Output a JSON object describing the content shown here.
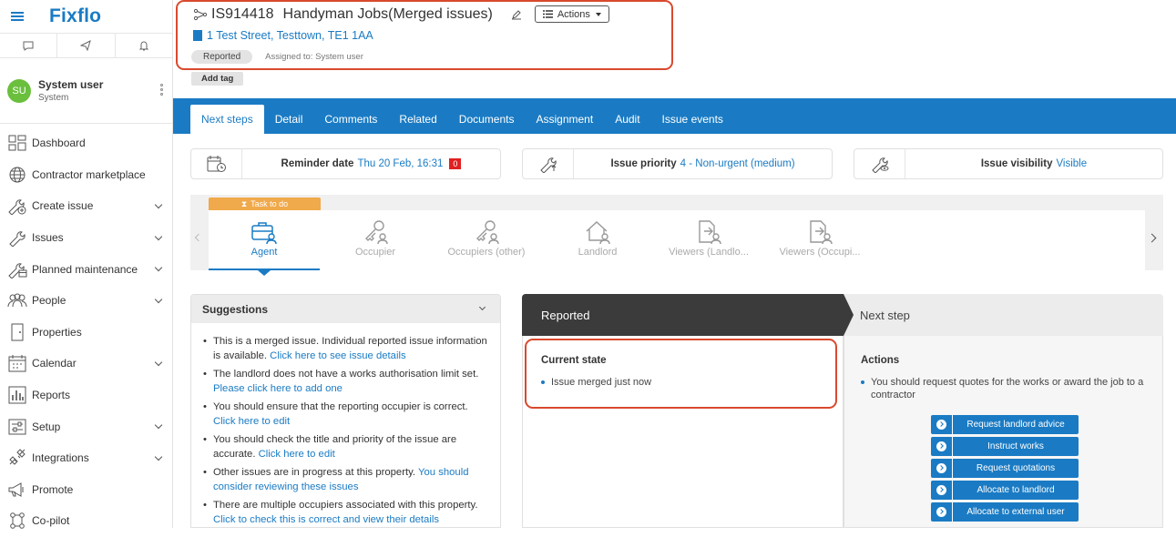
{
  "app": {
    "name": "Fixflo"
  },
  "sidebar": {
    "quick_icons": [
      "chat-icon",
      "send-icon",
      "bell-icon"
    ],
    "user": {
      "initials": "SU",
      "name": "System user",
      "role": "System",
      "avatar_color": "#6abf3d"
    },
    "items": [
      {
        "label": "Dashboard",
        "icon": "dashboard-icon",
        "has_submenu": false
      },
      {
        "label": "Contractor marketplace",
        "icon": "globe-icon",
        "has_submenu": false
      },
      {
        "label": "Create issue",
        "icon": "wrench-plus-icon",
        "has_submenu": true
      },
      {
        "label": "Issues",
        "icon": "wrench-icon",
        "has_submenu": true
      },
      {
        "label": "Planned maintenance",
        "icon": "wrench-calendar-icon",
        "has_submenu": true
      },
      {
        "label": "People",
        "icon": "people-icon",
        "has_submenu": true
      },
      {
        "label": "Properties",
        "icon": "door-icon",
        "has_submenu": false
      },
      {
        "label": "Calendar",
        "icon": "calendar-icon",
        "has_submenu": true
      },
      {
        "label": "Reports",
        "icon": "reports-icon",
        "has_submenu": false
      },
      {
        "label": "Setup",
        "icon": "setup-icon",
        "has_submenu": true
      },
      {
        "label": "Integrations",
        "icon": "integrations-icon",
        "has_submenu": true
      },
      {
        "label": "Promote",
        "icon": "megaphone-icon",
        "has_submenu": false
      },
      {
        "label": "Co-pilot",
        "icon": "copilot-icon",
        "has_submenu": false
      }
    ]
  },
  "issue": {
    "ref": "IS914418",
    "title": "Handyman Jobs(Merged issues)",
    "actions_label": "Actions",
    "address": "1 Test Street, Testtown, TE1 1AA",
    "status": "Reported",
    "assigned": "Assigned to: System user",
    "add_tag": "Add tag"
  },
  "tabs": [
    "Next steps",
    "Detail",
    "Comments",
    "Related",
    "Documents",
    "Assignment",
    "Audit",
    "Issue events"
  ],
  "cards": {
    "reminder": {
      "label": "Reminder date",
      "value": "Thu 20 Feb, 16:31",
      "badge": "0"
    },
    "priority": {
      "label": "Issue priority",
      "value": "4 - Non-urgent (medium)"
    },
    "visibility": {
      "label": "Issue visibility",
      "value": "Visible"
    }
  },
  "parties": {
    "task_label": "Task to do",
    "items": [
      "Agent",
      "Occupier",
      "Occupiers (other)",
      "Landlord",
      "Viewers (Landlo...",
      "Viewers (Occupi..."
    ]
  },
  "suggestions": {
    "title": "Suggestions",
    "items": [
      {
        "text": "This is a merged issue. Individual reported issue information is available.",
        "link": "Click here to see issue details"
      },
      {
        "text": "The landlord does not have a works authorisation limit set.",
        "link": "Please click here to add one"
      },
      {
        "text": "You should ensure that the reporting occupier is correct.",
        "link": "Click here to edit"
      },
      {
        "text": "You should check the title and priority of the issue are accurate.",
        "link": "Click here to edit"
      },
      {
        "text": "Other issues are in progress at this property.",
        "link": "You should consider reviewing these issues"
      },
      {
        "text": "There are multiple occupiers associated with this property.",
        "link": "Click to check this is correct and view their details"
      }
    ]
  },
  "workflow": {
    "current_label": "Reported",
    "next_label": "Next step",
    "current_state_title": "Current state",
    "current_state_item": "Issue merged just now",
    "actions_title": "Actions",
    "actions_item": "You should request quotes for the works or award the job to a contractor",
    "buttons": [
      "Request landlord advice",
      "Instruct works",
      "Request quotations",
      "Allocate to landlord",
      "Allocate to external user"
    ]
  },
  "colors": {
    "brand": "#1a7bc4",
    "task": "#f0a94b",
    "highlight": "#d9492e",
    "badge": "#e02020"
  }
}
